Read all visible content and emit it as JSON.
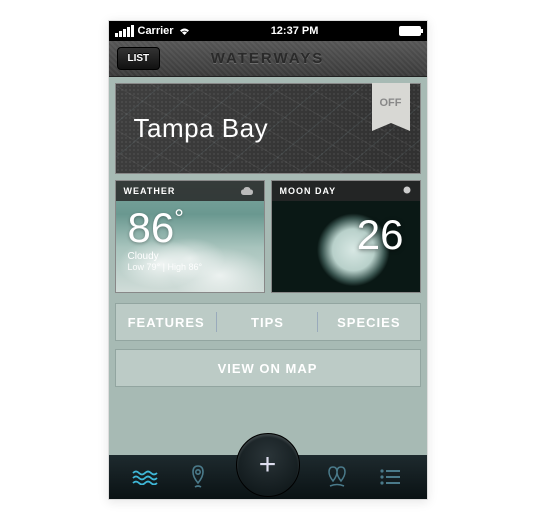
{
  "status": {
    "carrier": "Carrier",
    "time": "12:37 PM"
  },
  "nav": {
    "list_label": "LIST",
    "title": "WATERWAYS"
  },
  "hero": {
    "title": "Tampa Bay",
    "off_label": "OFF"
  },
  "weather": {
    "header": "WEATHER",
    "temp": "86",
    "condition": "Cloudy",
    "range": "Low 79° | High 86°"
  },
  "moon": {
    "header": "MOON DAY",
    "value": "26"
  },
  "segments": {
    "features": "FEATURES",
    "tips": "TIPS",
    "species": "SPECIES"
  },
  "map_btn": "VIEW ON MAP"
}
